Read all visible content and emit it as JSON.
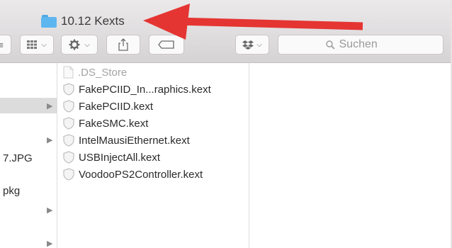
{
  "window": {
    "title": "10.12 Kexts"
  },
  "toolbar": {
    "view_label": "≡ ∨",
    "action_label": "✱ ∨",
    "share_icon": "share-icon",
    "tag_icon": "tag-icon",
    "dropbox_label": "∨",
    "search_placeholder": "Suchen"
  },
  "annotation": {
    "arrow_color": "#e53532"
  },
  "sidebar_column": {
    "rows": [
      {
        "label": ""
      },
      {
        "label": ""
      },
      {
        "label": ""
      },
      {
        "label": "7.JPG"
      },
      {
        "label": "pkg"
      }
    ]
  },
  "files": [
    {
      "name": ".DS_Store",
      "type": "document",
      "dim": true
    },
    {
      "name": "FakePCIID_In...raphics.kext",
      "type": "kext"
    },
    {
      "name": "FakePCIID.kext",
      "type": "kext"
    },
    {
      "name": "FakeSMC.kext",
      "type": "kext"
    },
    {
      "name": "IntelMausiEthernet.kext",
      "type": "kext"
    },
    {
      "name": "USBInjectAll.kext",
      "type": "kext"
    },
    {
      "name": "VoodooPS2Controller.kext",
      "type": "kext"
    }
  ]
}
